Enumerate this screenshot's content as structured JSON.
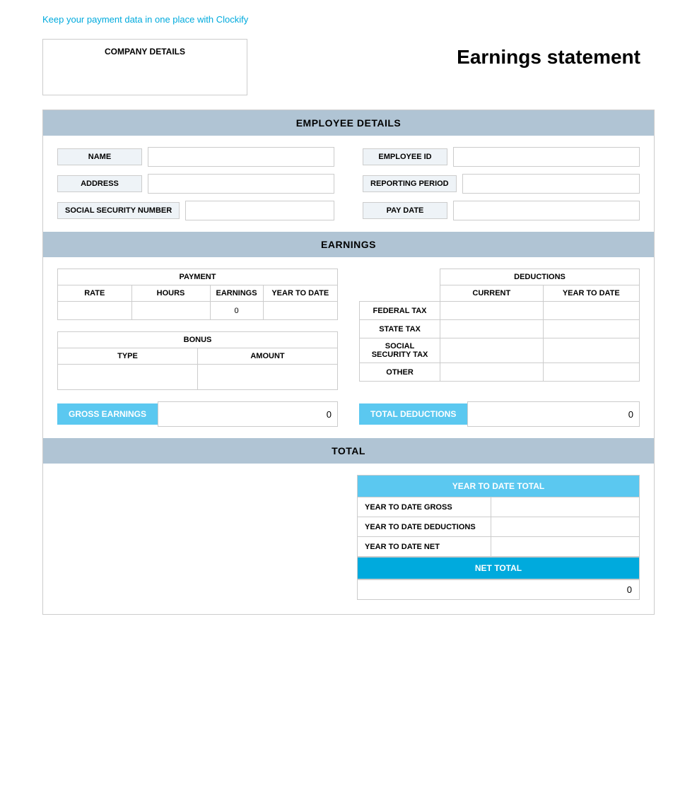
{
  "topLink": {
    "text": "Keep your payment data in one place with Clockify"
  },
  "header": {
    "companyLabel": "COMPANY DETAILS",
    "pageTitle": "Earnings statement"
  },
  "employeeDetails": {
    "sectionTitle": "EMPLOYEE DETAILS",
    "fields": {
      "name": "NAME",
      "address": "ADDRESS",
      "ssn": "SOCIAL SECURITY NUMBER",
      "employeeId": "EMPLOYEE ID",
      "reportingPeriod": "REPORTING PERIOD",
      "payDate": "PAY DATE"
    }
  },
  "earnings": {
    "sectionTitle": "EARNINGS",
    "payment": {
      "title": "PAYMENT",
      "headers": [
        "RATE",
        "HOURS",
        "EARNINGS",
        "YEAR TO DATE"
      ],
      "row": {
        "rate": "",
        "hours": "",
        "earnings": "0",
        "ytd": ""
      }
    },
    "deductions": {
      "title": "DEDUCTIONS",
      "headers": [
        "CURRENT",
        "YEAR TO DATE"
      ],
      "rows": [
        {
          "label": "FEDERAL TAX",
          "current": "",
          "ytd": ""
        },
        {
          "label": "STATE TAX",
          "current": "",
          "ytd": ""
        },
        {
          "label": "SOCIAL SECURITY TAX",
          "current": "",
          "ytd": ""
        },
        {
          "label": "OTHER",
          "current": "",
          "ytd": ""
        }
      ]
    },
    "bonus": {
      "title": "BONUS",
      "headers": [
        "TYPE",
        "AMOUNT"
      ],
      "row": {
        "type": "",
        "amount": ""
      }
    },
    "grossEarnings": {
      "label": "GROSS EARNINGS",
      "value": "0"
    },
    "totalDeductions": {
      "label": "TOTAL DEDUCTIONS",
      "value": "0"
    }
  },
  "total": {
    "sectionTitle": "TOTAL",
    "ytdTotal": {
      "header": "YEAR TO DATE TOTAL",
      "rows": [
        {
          "label": "YEAR TO DATE GROSS",
          "value": ""
        },
        {
          "label": "YEAR TO DATE DEDUCTIONS",
          "value": ""
        },
        {
          "label": "YEAR TO DATE NET",
          "value": ""
        }
      ]
    },
    "netTotal": {
      "label": "NET TOTAL",
      "value": "0"
    }
  }
}
